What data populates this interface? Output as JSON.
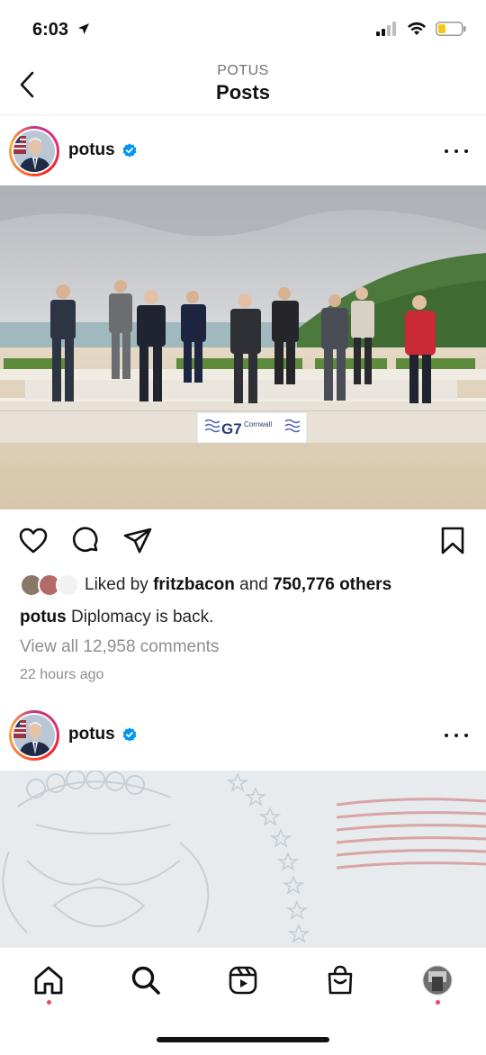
{
  "status_bar": {
    "time": "6:03",
    "icons": [
      "location-arrow-icon",
      "cellular-signal-icon",
      "wifi-icon",
      "battery-icon"
    ]
  },
  "header": {
    "subtitle": "POTUS",
    "title": "Posts",
    "back_icon": "chevron-left-icon"
  },
  "posts": [
    {
      "username": "potus",
      "verified": true,
      "banner_text": "G7",
      "banner_sub": "Cornwall",
      "liked_by_prefix": "Liked by",
      "liked_by_user": "fritzbacon",
      "liked_by_and": "and",
      "liked_by_others": "750,776 others",
      "caption_user": "potus",
      "caption_text": "Diplomacy is back.",
      "comments_link": "View all 12,958 comments",
      "timestamp": "22 hours ago"
    },
    {
      "username": "potus",
      "verified": true
    }
  ],
  "actions": [
    "heart-icon",
    "comment-icon",
    "share-icon",
    "bookmark-icon"
  ],
  "tabbar": {
    "tabs": [
      "home-icon",
      "search-icon",
      "reels-icon",
      "shop-icon",
      "profile-avatar"
    ],
    "active_indicator_color": "#ed4956"
  },
  "colors": {
    "verified": "#0095f6",
    "story_ring": "#e1306c"
  }
}
